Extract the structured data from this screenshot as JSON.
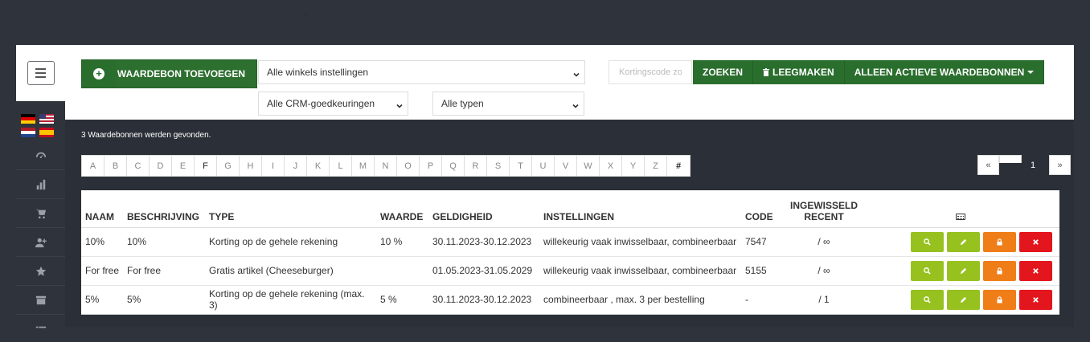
{
  "toolbar": {
    "add_label": "WAARDEBON TOEVOEGEN",
    "shops_select": "Alle winkels instellingen",
    "crm_select": "Alle CRM-goedkeuringen",
    "types_select": "Alle typen",
    "search_placeholder": "Kortingscode zo",
    "search_label": "ZOEKEN",
    "clear_label": "LEEGMAKEN",
    "active_label": "ALLEEN ACTIEVE WAARDEBONNEN",
    "accent": "#2a6e2d"
  },
  "found_text": "3 Waardebonnen werden gevonden.",
  "alphabet": [
    "A",
    "B",
    "C",
    "D",
    "E",
    "F",
    "G",
    "H",
    "I",
    "J",
    "K",
    "L",
    "M",
    "N",
    "O",
    "P",
    "Q",
    "R",
    "S",
    "T",
    "U",
    "V",
    "W",
    "X",
    "Y",
    "Z",
    "#"
  ],
  "pager": {
    "prev": "«",
    "current": "1",
    "next": "»"
  },
  "table": {
    "headers": {
      "name": "NAAM",
      "description": "BESCHRIJVING",
      "type": "TYPE",
      "value": "WAARDE",
      "validity": "GELDIGHEID",
      "settings": "INSTELLINGEN",
      "code": "CODE",
      "redeemed_1": "INGEWISSELD",
      "redeemed_2": "RECENT"
    },
    "rows": [
      {
        "name": "10%",
        "description": "10%",
        "type": "Korting op de gehele rekening",
        "value": "10 %",
        "validity": "30.11.2023-30.12.2023",
        "settings": "willekeurig vaak inwisselbaar, combineerbaar",
        "code": "7547",
        "redeemed": "/ ∞"
      },
      {
        "name": "For free",
        "description": "For free",
        "type": "Gratis artikel (Cheeseburger)",
        "value": "",
        "validity": "01.05.2023-31.05.2029",
        "settings": "willekeurig vaak inwisselbaar, combineerbaar",
        "code": "5155",
        "redeemed": "/ ∞"
      },
      {
        "name": "5%",
        "description": "5%",
        "type": "Korting op de gehele rekening (max. 3)",
        "value": "5 %",
        "validity": "30.11.2023-30.12.2023",
        "settings": "combineerbaar , max. 3 per bestelling",
        "code": "-",
        "redeemed": "/ 1"
      }
    ]
  },
  "sidebar": {
    "icons": [
      "dashboard-icon",
      "chart-icon",
      "cart-icon",
      "user-plus-icon",
      "star-icon",
      "archive-icon",
      "list-icon"
    ]
  }
}
